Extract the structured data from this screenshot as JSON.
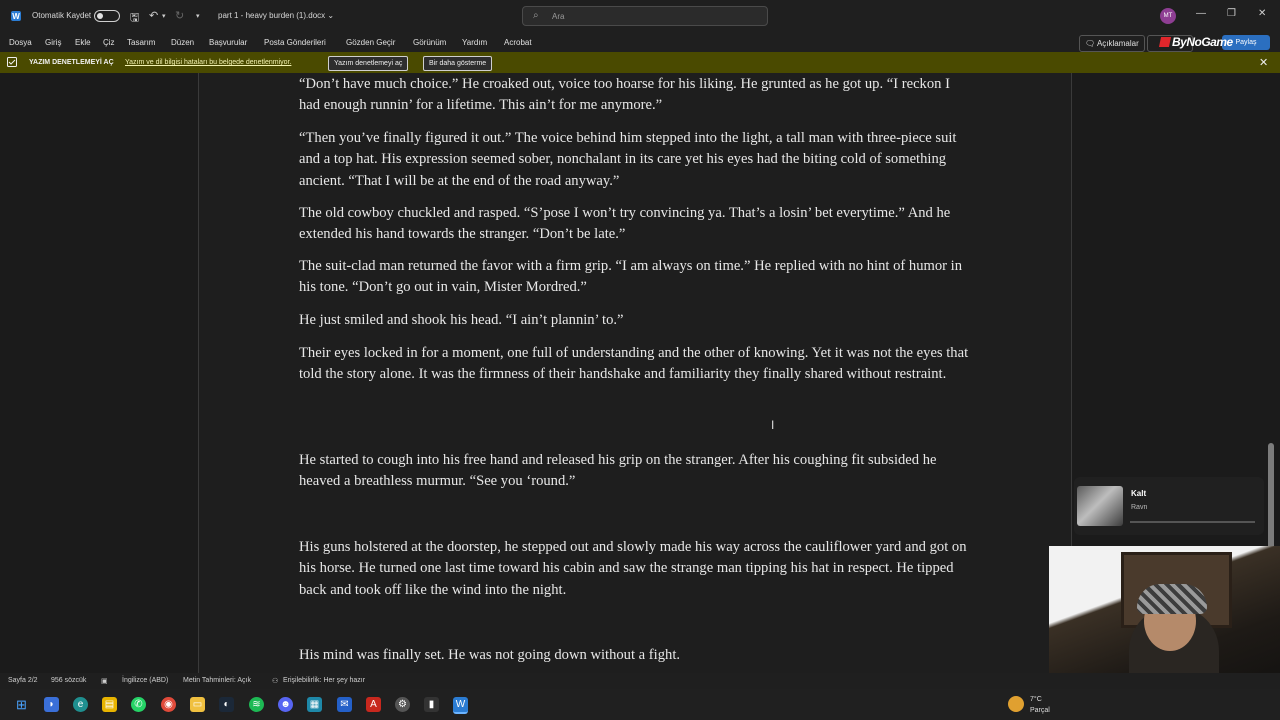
{
  "titlebar": {
    "autosave_label": "Otomatik Kaydet",
    "doc_title": "part 1 - heavy burden (1).docx",
    "search_placeholder": "Ara",
    "avatar_initials": "MT"
  },
  "ribbon": {
    "tabs": [
      "Dosya",
      "Giriş",
      "Ekle",
      "Çiz",
      "Tasarım",
      "Düzen",
      "Başvurular",
      "Posta Gönderileri",
      "Gözden Geçir",
      "Görünüm",
      "Yardım",
      "Acrobat"
    ],
    "comments_label": "Açıklamalar",
    "share_label": "Paylaş",
    "overlay_logo": "ByNoGame"
  },
  "notification": {
    "title": "YAZIM DENETLEMEYİ AÇ",
    "message": "Yazım ve dil bilgisi hataları bu belgede denetlenmiyor.",
    "enable_button": "Yazım denetlemeyi aç",
    "dismiss_button": "Bir daha gösterme"
  },
  "document": {
    "paragraphs": [
      "“Don’t have much choice.” He croaked out, voice too hoarse for his liking. He grunted as he got up. “I reckon I had enough runnin’ for a lifetime. This ain’t for me anymore.”",
      "“Then you’ve finally figured it out.” The voice behind him stepped into the light, a tall man with three-piece suit and a top hat. His expression seemed sober, nonchalant in its care yet his eyes had the biting cold of something ancient. “That I will be at the end of the road anyway.”",
      "The old cowboy chuckled and rasped. “S’pose I won’t try convincing ya. That’s a losin’ bet everytime.” And he extended his hand towards the stranger. “Don’t be late.”",
      "The suit-clad man returned the favor with a firm grip. “I am always on time.” He replied with no hint of humor in his tone. “Don’t go out in vain, Mister Mordred.”",
      "He just smiled and shook his head. “I ain’t plannin’ to.”",
      "Their eyes locked in for a moment, one full of understanding and the other of knowing. Yet it was not the eyes that told the story alone. It was the firmness of their handshake and familiarity they finally shared without restraint.",
      "He started to cough into his free hand and released his grip on the stranger. After his coughing fit subsided he heaved a breathless murmur. “See you ‘round.”",
      "His guns holstered at the doorstep, he stepped out and slowly made his way across the cauliflower yard and got on his horse. He turned one last time toward his cabin and saw the strange man tipping his hat in respect. He tipped back and took off like the wind into the night.",
      "His mind was finally set. He was not going down without a fight."
    ]
  },
  "media": {
    "track_title": "Kalt",
    "track_artist": "Ravn"
  },
  "statusbar": {
    "page": "Sayfa 2/2",
    "words": "956 sözcük",
    "language": "İngilizce (ABD)",
    "text_predictions": "Metin Tahminleri: Açık",
    "accessibility": "Erişilebilirlik: Her şey hazır"
  },
  "taskbar": {
    "weather_temp": "7°C",
    "weather_cond": "Parçal"
  },
  "colors": {
    "accent": "#2b7cd3",
    "notification_bg": "#4a4a00",
    "page_bg": "#1e1e1e"
  }
}
